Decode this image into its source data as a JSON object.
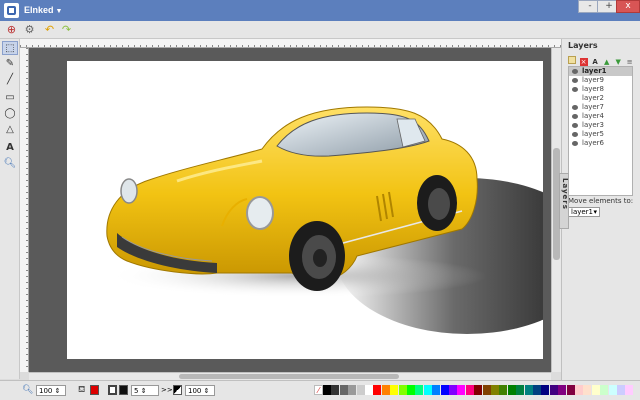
{
  "app": {
    "title": "Elnked",
    "min": "-",
    "max": "+",
    "close": "x"
  },
  "toolbar": {
    "undo": "↶",
    "redo": "↷"
  },
  "layers": {
    "title": "Layers",
    "items": [
      {
        "label": "layer1",
        "selected": true
      },
      {
        "label": "layer9"
      },
      {
        "label": "layer8"
      },
      {
        "label": "layer2"
      },
      {
        "label": "layer7"
      },
      {
        "label": "layer4"
      },
      {
        "label": "layer3"
      },
      {
        "label": "layer5"
      },
      {
        "label": "layer6"
      }
    ],
    "move_label": "Move elements to:",
    "move_value": "layer1",
    "tab_label": "Layers"
  },
  "bottom": {
    "zoom": "100",
    "stroke_width": "5",
    "opacity": "100",
    "arrows": ">>"
  },
  "colors": {
    "titlebar": "#5c7fbd",
    "car_body": "#f2c313",
    "fill": "#dd0000",
    "stroke": "#111111",
    "palette": [
      "#000000",
      "#333333",
      "#666666",
      "#999999",
      "#cccccc",
      "#ffffff",
      "#ff0000",
      "#ff8000",
      "#ffff00",
      "#80ff00",
      "#00ff00",
      "#00ff80",
      "#00ffff",
      "#0080ff",
      "#0000ff",
      "#8000ff",
      "#ff00ff",
      "#ff0080",
      "#800000",
      "#804000",
      "#808000",
      "#408000",
      "#008000",
      "#008040",
      "#008080",
      "#004080",
      "#000080",
      "#400080",
      "#800080",
      "#800040",
      "#ffcccc",
      "#ffe0cc",
      "#ffffcc",
      "#ccffcc",
      "#ccffff",
      "#ccccff",
      "#ffccff"
    ]
  }
}
